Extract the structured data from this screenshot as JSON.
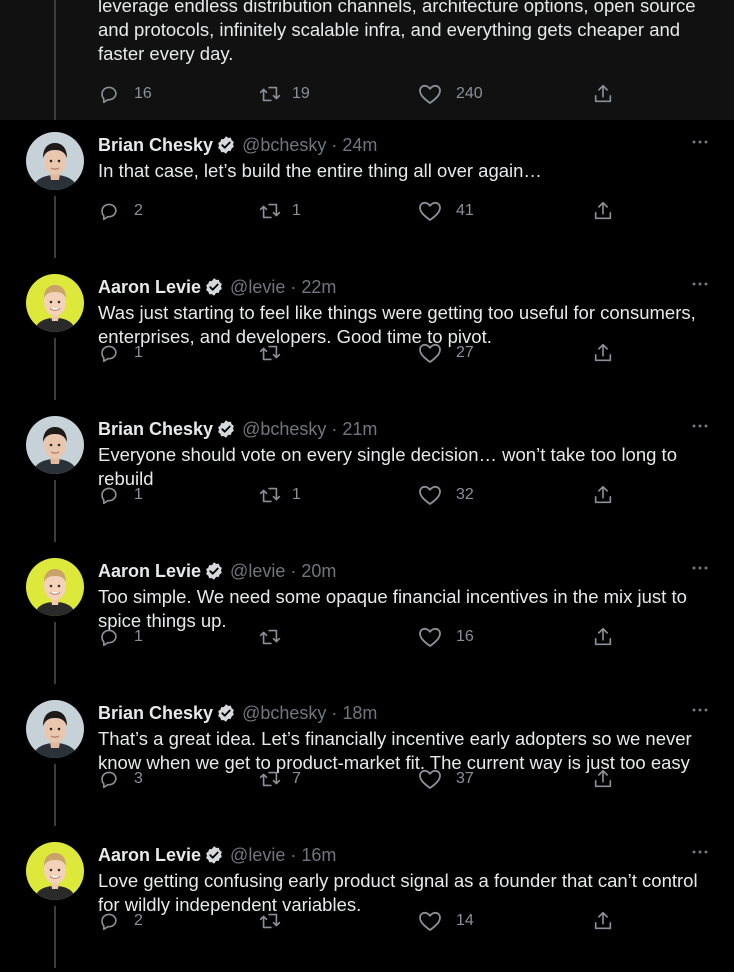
{
  "colors": {
    "background": "#000000",
    "top_tweet_background": "#111111",
    "text": "#e7e9ea",
    "secondary": "#71767b",
    "verified": "#d6d9db",
    "thread_line": "#3a3d40"
  },
  "top_tweet": {
    "text": "leverage endless distribution channels, architecture options, open source and protocols, infinitely scalable infra, and everything gets cheaper and faster every day.",
    "replies": "16",
    "retweets": "19",
    "likes": "240"
  },
  "tweets": [
    {
      "name": "Brian Chesky",
      "handle": "@bchesky",
      "time": "24m",
      "text": "In that case, let’s build the entire thing all over again…",
      "replies": "2",
      "retweets": "1",
      "likes": "41",
      "avatar": "avatar-brian"
    },
    {
      "name": "Aaron Levie",
      "handle": "@levie",
      "time": "22m",
      "text": "Was just starting to feel like things were getting too useful for consumers, enterprises, and developers. Good time to pivot.",
      "replies": "1",
      "retweets": "",
      "likes": "27",
      "avatar": "avatar-aaron"
    },
    {
      "name": "Brian Chesky",
      "handle": "@bchesky",
      "time": "21m",
      "text": "Everyone should vote on every single decision… won’t take too long to rebuild",
      "replies": "1",
      "retweets": "1",
      "likes": "32",
      "avatar": "avatar-brian"
    },
    {
      "name": "Aaron Levie",
      "handle": "@levie",
      "time": "20m",
      "text": "Too simple. We need some opaque financial incentives in the mix just to spice things up.",
      "replies": "1",
      "retweets": "",
      "likes": "16",
      "avatar": "avatar-aaron"
    },
    {
      "name": "Brian Chesky",
      "handle": "@bchesky",
      "time": "18m",
      "text": "That’s a great idea. Let’s financially incentive early adopters so we never know when we get to product-market fit. The current way is just too easy",
      "replies": "3",
      "retweets": "7",
      "likes": "37",
      "avatar": "avatar-brian"
    },
    {
      "name": "Aaron Levie",
      "handle": "@levie",
      "time": "16m",
      "text": "Love getting confusing early product signal as a founder that can’t control for wildly independent variables.",
      "replies": "2",
      "retweets": "",
      "likes": "14",
      "avatar": "avatar-aaron"
    }
  ]
}
